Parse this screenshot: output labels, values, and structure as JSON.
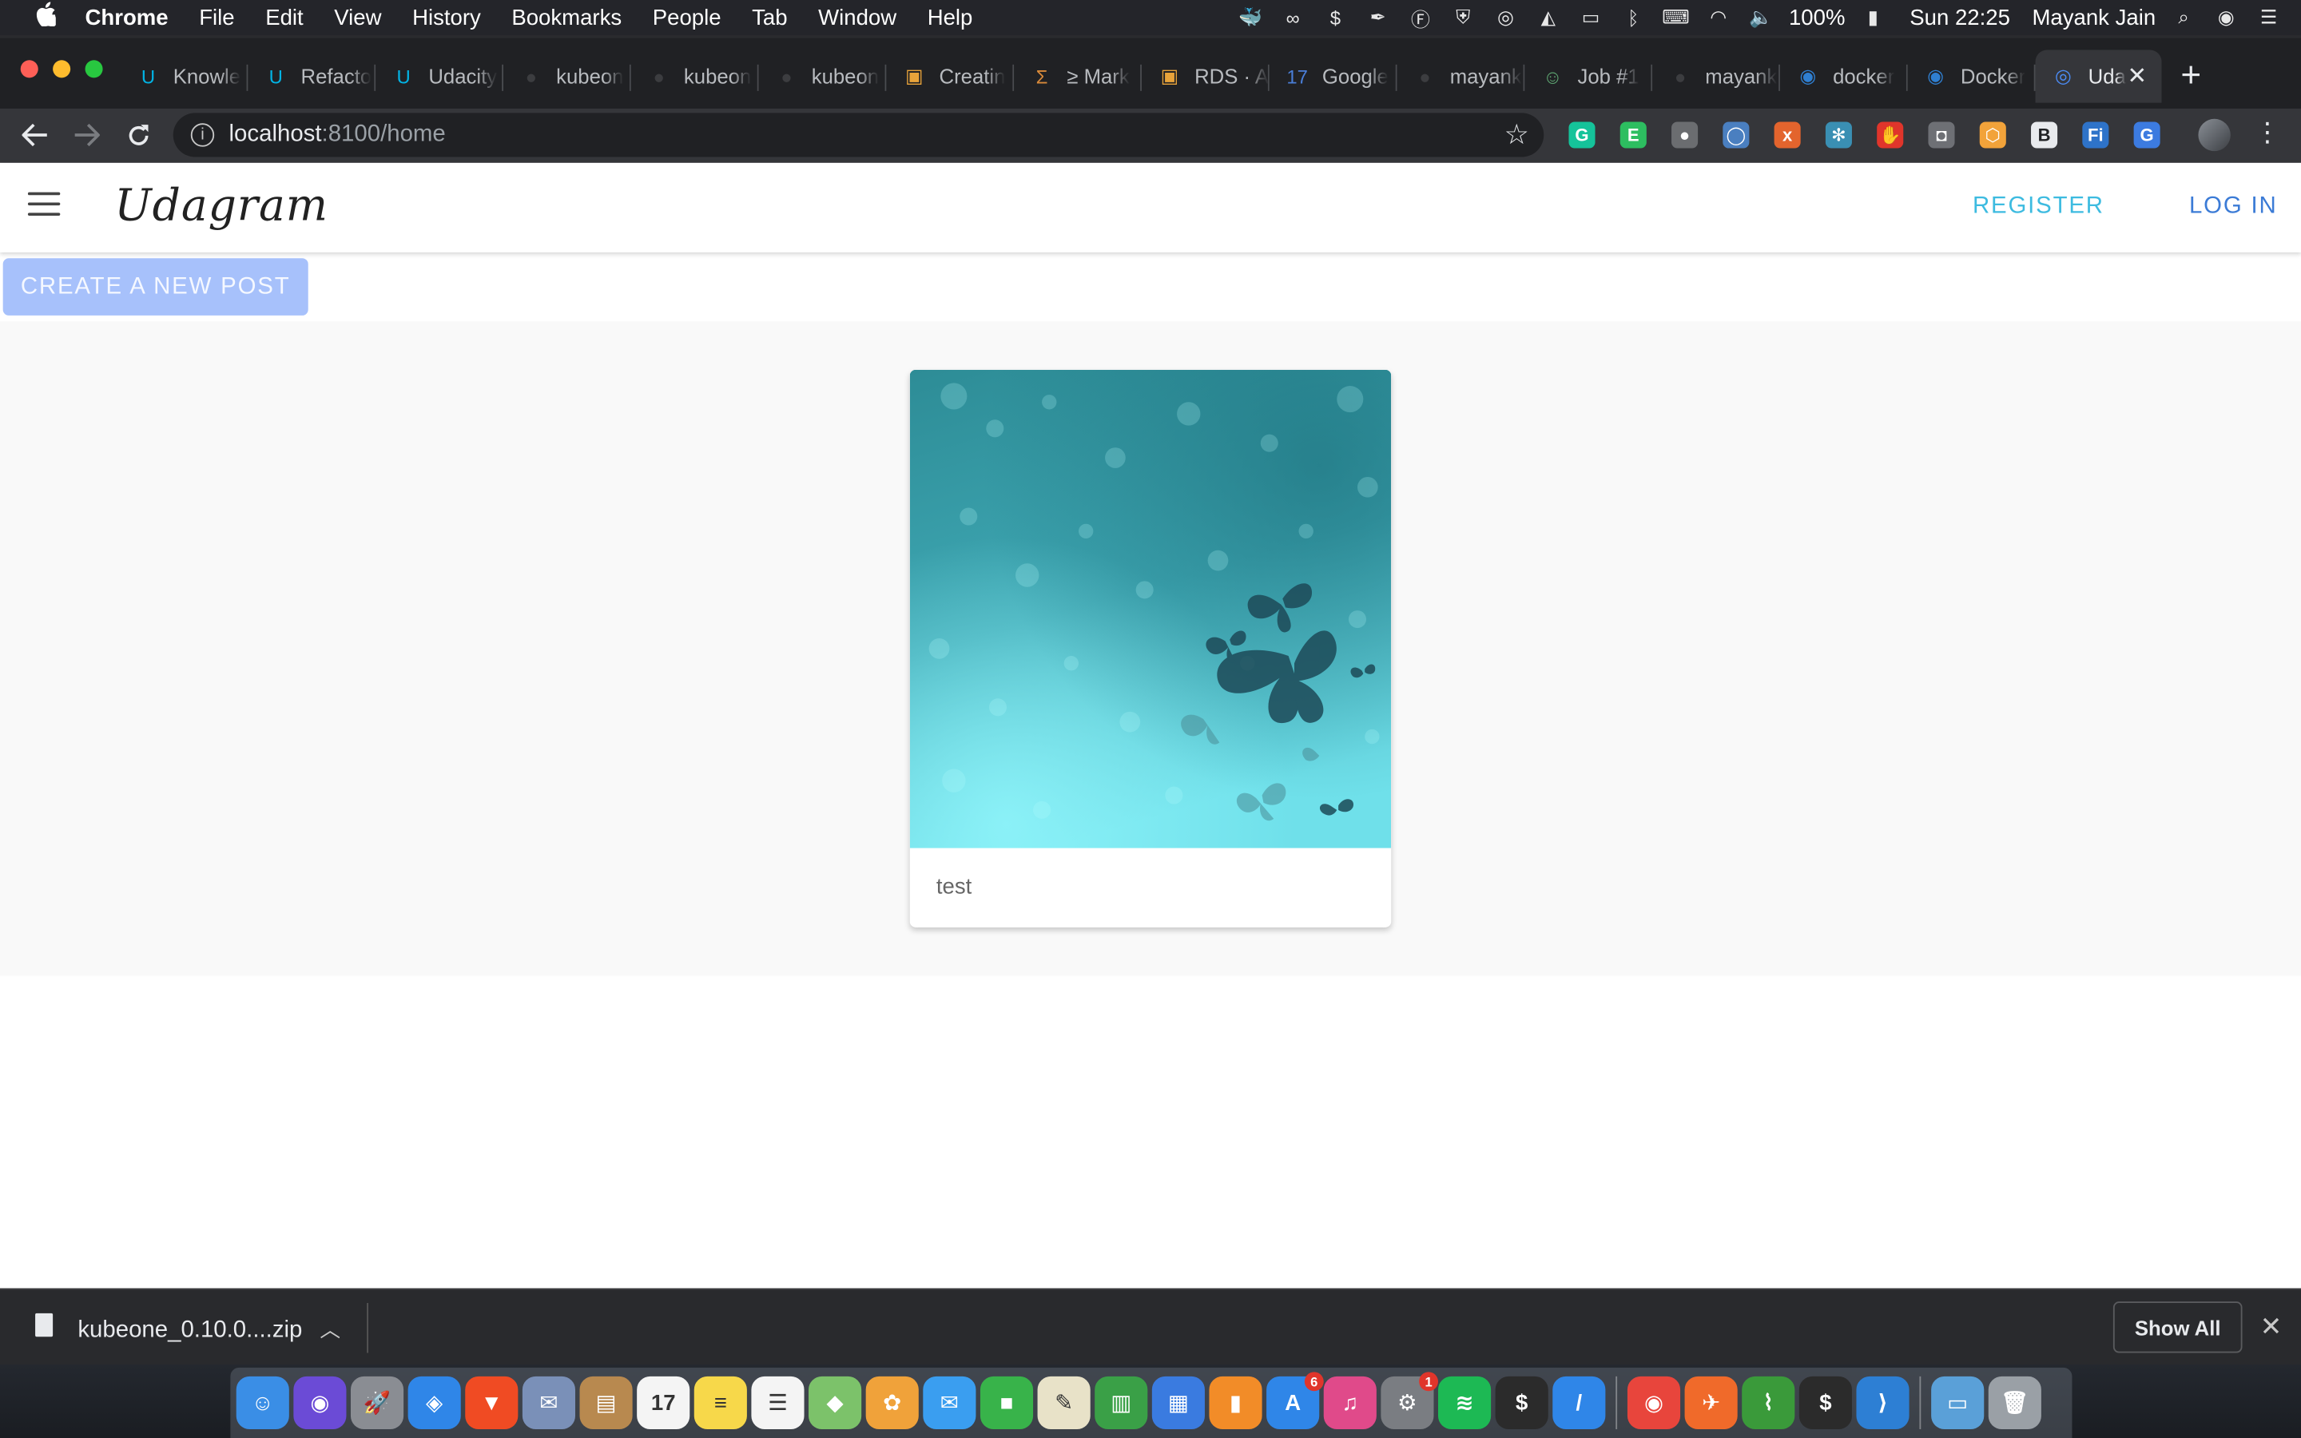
{
  "menubar": {
    "apple": "",
    "items": [
      "Chrome",
      "File",
      "Edit",
      "View",
      "History",
      "Bookmarks",
      "People",
      "Tab",
      "Window",
      "Help"
    ],
    "battery": "100%",
    "clock": "Sun 22:25",
    "user": "Mayank Jain"
  },
  "tabs": [
    {
      "label": "Knowle",
      "icon": "udacity-icon",
      "color": "#02b3e4",
      "glyph": "U"
    },
    {
      "label": "Refacto",
      "icon": "udacity-icon",
      "color": "#02b3e4",
      "glyph": "U"
    },
    {
      "label": "Udacity",
      "icon": "udacity-icon",
      "color": "#02b3e4",
      "glyph": "U"
    },
    {
      "label": "kubeon",
      "icon": "github-icon",
      "color": "#3c3d40",
      "glyph": "●"
    },
    {
      "label": "kubeon",
      "icon": "github-icon",
      "color": "#3c3d40",
      "glyph": "●"
    },
    {
      "label": "kubeon",
      "icon": "github-icon",
      "color": "#3c3d40",
      "glyph": "●"
    },
    {
      "label": "Creatin",
      "icon": "aws-box-icon",
      "color": "#e8a33a",
      "glyph": "▣"
    },
    {
      "label": "≥ Mark",
      "icon": "sigma-icon",
      "color": "#d98a3a",
      "glyph": "Σ"
    },
    {
      "label": "RDS · A",
      "icon": "aws-box-icon",
      "color": "#e8a33a",
      "glyph": "▣"
    },
    {
      "label": "Google",
      "icon": "calendar-icon",
      "color": "#4a7ed8",
      "glyph": "17"
    },
    {
      "label": "mayank",
      "icon": "github-icon",
      "color": "#3c3d40",
      "glyph": "●"
    },
    {
      "label": "Job #1",
      "icon": "jenkins-icon",
      "color": "#5fa873",
      "glyph": "☺"
    },
    {
      "label": "mayank",
      "icon": "github-icon",
      "color": "#3c3d40",
      "glyph": "●"
    },
    {
      "label": "docker",
      "icon": "docker-icon",
      "color": "#2f7fd1",
      "glyph": "◉"
    },
    {
      "label": "Docker",
      "icon": "docker-icon",
      "color": "#2f7fd1",
      "glyph": "◉"
    },
    {
      "label": "Uda",
      "icon": "ionic-icon",
      "color": "#4b8bf4",
      "glyph": "◎",
      "active": true
    }
  ],
  "toolbar": {
    "url_host": "localhost",
    "url_path": ":8100/home"
  },
  "extensions": [
    {
      "name": "grammarly-icon",
      "color": "#15c39a",
      "glyph": "G"
    },
    {
      "name": "evernote-icon",
      "color": "#2dbe60",
      "glyph": "E"
    },
    {
      "name": "bulb-icon",
      "color": "#6b6d70",
      "glyph": "●"
    },
    {
      "name": "circle-ext-icon",
      "color": "#4a7fc0",
      "glyph": "◯"
    },
    {
      "name": "xml-icon",
      "color": "#e3642d",
      "glyph": "x"
    },
    {
      "name": "react-icon",
      "color": "#3a8fb3",
      "glyph": "✻"
    },
    {
      "name": "adblock-icon",
      "color": "#e0352b",
      "glyph": "✋"
    },
    {
      "name": "camera-icon",
      "color": "#6e7075",
      "glyph": "◘"
    },
    {
      "name": "hex-ext-icon",
      "color": "#f2a33a",
      "glyph": "⬡"
    },
    {
      "name": "b-ext-icon",
      "color": "#e8eaed",
      "glyph": "B"
    },
    {
      "name": "fi-ext-icon",
      "color": "#2e73c9",
      "glyph": "Fi"
    },
    {
      "name": "translate-icon",
      "color": "#3c7be0",
      "glyph": "G"
    }
  ],
  "app": {
    "brand": "Udagram",
    "register": "REGISTER",
    "login": "LOG IN",
    "create_post": "CREATE A NEW POST"
  },
  "post": {
    "caption": "test"
  },
  "download_shelf": {
    "file": "kubeone_0.10.0....zip",
    "show_all": "Show All"
  },
  "dock": [
    {
      "name": "finder-icon",
      "color": "#3a8ee6",
      "glyph": "☺"
    },
    {
      "name": "siri-icon",
      "color": "#6b4bd6",
      "glyph": "◉"
    },
    {
      "name": "launchpad-icon",
      "color": "#8a8d93",
      "glyph": "🚀"
    },
    {
      "name": "safari-icon",
      "color": "#2f86e8",
      "glyph": "◈"
    },
    {
      "name": "brave-icon",
      "color": "#f04b23",
      "glyph": "▼"
    },
    {
      "name": "mail-bird-icon",
      "color": "#7a90b8",
      "glyph": "✉"
    },
    {
      "name": "contacts-icon",
      "color": "#b8894f",
      "glyph": "▤"
    },
    {
      "name": "calendar-icon",
      "color": "#f4f4f4",
      "glyph": "17",
      "dark": true
    },
    {
      "name": "notes-icon",
      "color": "#f7d84a",
      "glyph": "≡",
      "dark": true
    },
    {
      "name": "reminders-icon",
      "color": "#f4f4f4",
      "glyph": "☰",
      "dark": true
    },
    {
      "name": "maps-icon",
      "color": "#7cc26a",
      "glyph": "◆"
    },
    {
      "name": "photos-icon",
      "color": "#f0a23a",
      "glyph": "✿"
    },
    {
      "name": "messages-icon",
      "color": "#3a9ef0",
      "glyph": "✉"
    },
    {
      "name": "facetime-icon",
      "color": "#38b34a",
      "glyph": "■"
    },
    {
      "name": "textedit-icon",
      "color": "#e8e2c8",
      "glyph": "✎",
      "dark": true
    },
    {
      "name": "numbers-icon",
      "color": "#3aa047",
      "glyph": "▥"
    },
    {
      "name": "keynote-icon",
      "color": "#3a7be0",
      "glyph": "▦"
    },
    {
      "name": "books-icon",
      "color": "#f28c28",
      "glyph": "▮"
    },
    {
      "name": "app-store-icon",
      "color": "#2f86e8",
      "glyph": "A",
      "badge": "6"
    },
    {
      "name": "itunes-icon",
      "color": "#e04a8a",
      "glyph": "♫"
    },
    {
      "name": "system-prefs-icon",
      "color": "#7a7d82",
      "glyph": "⚙",
      "badge": "1"
    },
    {
      "name": "spotify-icon",
      "color": "#1db954",
      "glyph": "≋"
    },
    {
      "name": "terminal-icon",
      "color": "#2b2b2b",
      "glyph": "$"
    },
    {
      "name": "instruments-icon",
      "color": "#2f86e8",
      "glyph": "/"
    },
    {
      "sep": true
    },
    {
      "name": "chrome-icon",
      "color": "#e8453c",
      "glyph": "◉"
    },
    {
      "name": "postman-icon",
      "color": "#f06a2a",
      "glyph": "✈"
    },
    {
      "name": "tool-icon",
      "color": "#3a9a3a",
      "glyph": "⌇"
    },
    {
      "name": "terminal-2-icon",
      "color": "#2b2b2b",
      "glyph": "$"
    },
    {
      "name": "vscode-icon",
      "color": "#2d7fd4",
      "glyph": "⟩"
    },
    {
      "sep": true
    },
    {
      "name": "downloads-folder-icon",
      "color": "#5aa0d8",
      "glyph": "▭"
    },
    {
      "name": "trash-icon",
      "color": "#9aa0a6",
      "glyph": "🗑"
    }
  ]
}
